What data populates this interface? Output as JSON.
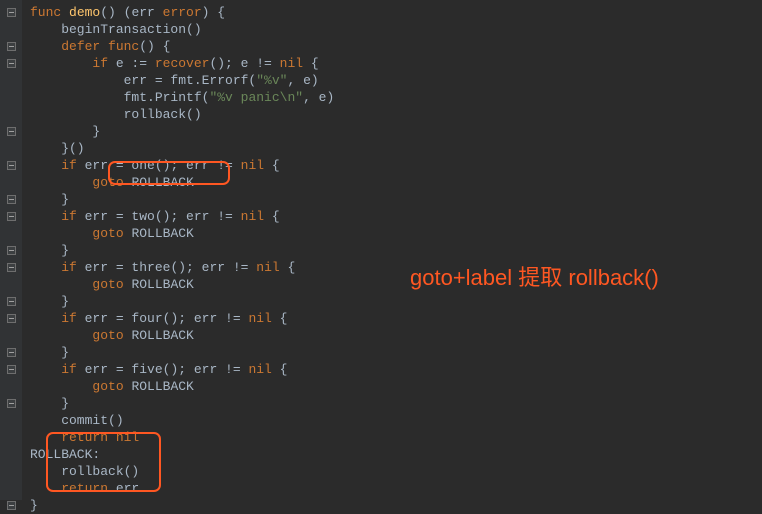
{
  "annotation": "goto+label 提取 rollback()",
  "gutter": [
    {
      "t": "fold"
    },
    {
      "t": ""
    },
    {
      "t": "fold"
    },
    {
      "t": "fold"
    },
    {
      "t": ""
    },
    {
      "t": ""
    },
    {
      "t": ""
    },
    {
      "t": "end"
    },
    {
      "t": ""
    },
    {
      "t": "fold"
    },
    {
      "t": ""
    },
    {
      "t": "end"
    },
    {
      "t": "fold"
    },
    {
      "t": ""
    },
    {
      "t": "end"
    },
    {
      "t": "fold"
    },
    {
      "t": ""
    },
    {
      "t": "end"
    },
    {
      "t": "fold"
    },
    {
      "t": ""
    },
    {
      "t": "end"
    },
    {
      "t": "fold"
    },
    {
      "t": ""
    },
    {
      "t": "end"
    },
    {
      "t": ""
    },
    {
      "t": ""
    },
    {
      "t": ""
    },
    {
      "t": ""
    },
    {
      "t": ""
    },
    {
      "t": "end"
    }
  ],
  "code": {
    "lines": [
      [
        {
          "c": "kw",
          "t": "func "
        },
        {
          "c": "fn",
          "t": "demo"
        },
        {
          "c": "",
          "t": "() (err "
        },
        {
          "c": "kw",
          "t": "error"
        },
        {
          "c": "",
          "t": ") {"
        }
      ],
      [
        {
          "c": "",
          "t": "    beginTransaction()"
        }
      ],
      [
        {
          "c": "",
          "t": "    "
        },
        {
          "c": "kw",
          "t": "defer func"
        },
        {
          "c": "",
          "t": "() {"
        }
      ],
      [
        {
          "c": "",
          "t": "        "
        },
        {
          "c": "kw",
          "t": "if "
        },
        {
          "c": "",
          "t": "e := "
        },
        {
          "c": "builtin",
          "t": "recover"
        },
        {
          "c": "",
          "t": "(); e != "
        },
        {
          "c": "kw",
          "t": "nil "
        },
        {
          "c": "",
          "t": "{"
        }
      ],
      [
        {
          "c": "",
          "t": "            err = fmt.Errorf("
        },
        {
          "c": "str",
          "t": "\"%v\""
        },
        {
          "c": "",
          "t": ", e)"
        }
      ],
      [
        {
          "c": "",
          "t": "            fmt.Printf("
        },
        {
          "c": "str",
          "t": "\"%v panic\\n\""
        },
        {
          "c": "",
          "t": ", e)"
        }
      ],
      [
        {
          "c": "",
          "t": "            rollback()"
        }
      ],
      [
        {
          "c": "",
          "t": "        }"
        }
      ],
      [
        {
          "c": "",
          "t": "    }()"
        }
      ],
      [
        {
          "c": "",
          "t": "    "
        },
        {
          "c": "kw",
          "t": "if "
        },
        {
          "c": "",
          "t": "err = one(); err != "
        },
        {
          "c": "kw",
          "t": "nil "
        },
        {
          "c": "",
          "t": "{"
        }
      ],
      [
        {
          "c": "",
          "t": "        "
        },
        {
          "c": "kw",
          "t": "goto "
        },
        {
          "c": "",
          "t": "ROLLBACK"
        }
      ],
      [
        {
          "c": "",
          "t": "    }"
        }
      ],
      [
        {
          "c": "",
          "t": "    "
        },
        {
          "c": "kw",
          "t": "if "
        },
        {
          "c": "",
          "t": "err = two(); err != "
        },
        {
          "c": "kw",
          "t": "nil "
        },
        {
          "c": "",
          "t": "{"
        }
      ],
      [
        {
          "c": "",
          "t": "        "
        },
        {
          "c": "kw",
          "t": "goto "
        },
        {
          "c": "",
          "t": "ROLLBACK"
        }
      ],
      [
        {
          "c": "",
          "t": "    }"
        }
      ],
      [
        {
          "c": "",
          "t": "    "
        },
        {
          "c": "kw",
          "t": "if "
        },
        {
          "c": "",
          "t": "err = three(); err != "
        },
        {
          "c": "kw",
          "t": "nil "
        },
        {
          "c": "",
          "t": "{"
        }
      ],
      [
        {
          "c": "",
          "t": "        "
        },
        {
          "c": "kw",
          "t": "goto "
        },
        {
          "c": "",
          "t": "ROLLBACK"
        }
      ],
      [
        {
          "c": "",
          "t": "    }"
        }
      ],
      [
        {
          "c": "",
          "t": "    "
        },
        {
          "c": "kw",
          "t": "if "
        },
        {
          "c": "",
          "t": "err = four(); err != "
        },
        {
          "c": "kw",
          "t": "nil "
        },
        {
          "c": "",
          "t": "{"
        }
      ],
      [
        {
          "c": "",
          "t": "        "
        },
        {
          "c": "kw",
          "t": "goto "
        },
        {
          "c": "",
          "t": "ROLLBACK"
        }
      ],
      [
        {
          "c": "",
          "t": "    }"
        }
      ],
      [
        {
          "c": "",
          "t": "    "
        },
        {
          "c": "kw",
          "t": "if "
        },
        {
          "c": "",
          "t": "err = five(); err != "
        },
        {
          "c": "kw",
          "t": "nil "
        },
        {
          "c": "",
          "t": "{"
        }
      ],
      [
        {
          "c": "",
          "t": "        "
        },
        {
          "c": "kw",
          "t": "goto "
        },
        {
          "c": "",
          "t": "ROLLBACK"
        }
      ],
      [
        {
          "c": "",
          "t": "    }"
        }
      ],
      [
        {
          "c": "",
          "t": "    commit()"
        }
      ],
      [
        {
          "c": "",
          "t": "    "
        },
        {
          "c": "kw",
          "t": "return "
        },
        {
          "c": "kw",
          "t": "nil"
        }
      ],
      [
        {
          "c": "",
          "t": "ROLLBACK:"
        }
      ],
      [
        {
          "c": "",
          "t": "    rollback()"
        }
      ],
      [
        {
          "c": "",
          "t": "    "
        },
        {
          "c": "kw",
          "t": "return "
        },
        {
          "c": "",
          "t": "err"
        }
      ],
      [
        {
          "c": "",
          "t": "}"
        }
      ]
    ]
  }
}
